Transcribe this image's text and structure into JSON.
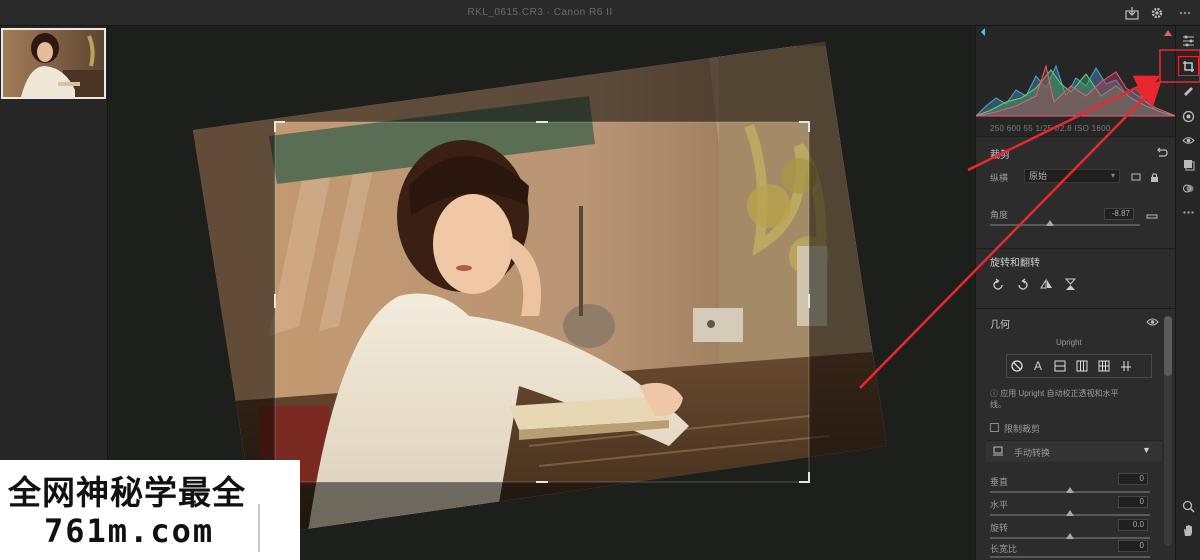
{
  "window": {
    "title": "RKL_0615.CR3  ·  Canon R6 II"
  },
  "histogram": {
    "readout": "250 600  55  1/25    f/2.8  ISO 1600"
  },
  "crop_panel": {
    "title": "裁剪",
    "aspect_label": "纵横",
    "aspect_value": "原始",
    "angle_label": "角度",
    "angle_value": "-8.87"
  },
  "rotate_panel": {
    "title": "旋转和翻转"
  },
  "geometry_panel": {
    "title": "几何",
    "mode_caption": "Upright",
    "info_text": "应用 Upright 自动校正透视和水平",
    "info_text2": "线。",
    "constrain_label": "限制裁剪",
    "manual_title": "手动转换",
    "sliders": [
      {
        "label": "垂直",
        "value": "0"
      },
      {
        "label": "水平",
        "value": "0"
      },
      {
        "label": "旋转",
        "value": "0.0"
      },
      {
        "label": "长宽比",
        "value": "0"
      }
    ]
  },
  "watermark": {
    "line1": "全网神秘学最全",
    "line2": "761m.com"
  },
  "colors": {
    "annotation_red": "#e8282e",
    "panel_bg": "#2c2c2c",
    "canvas_bg": "#1d1f1d"
  }
}
